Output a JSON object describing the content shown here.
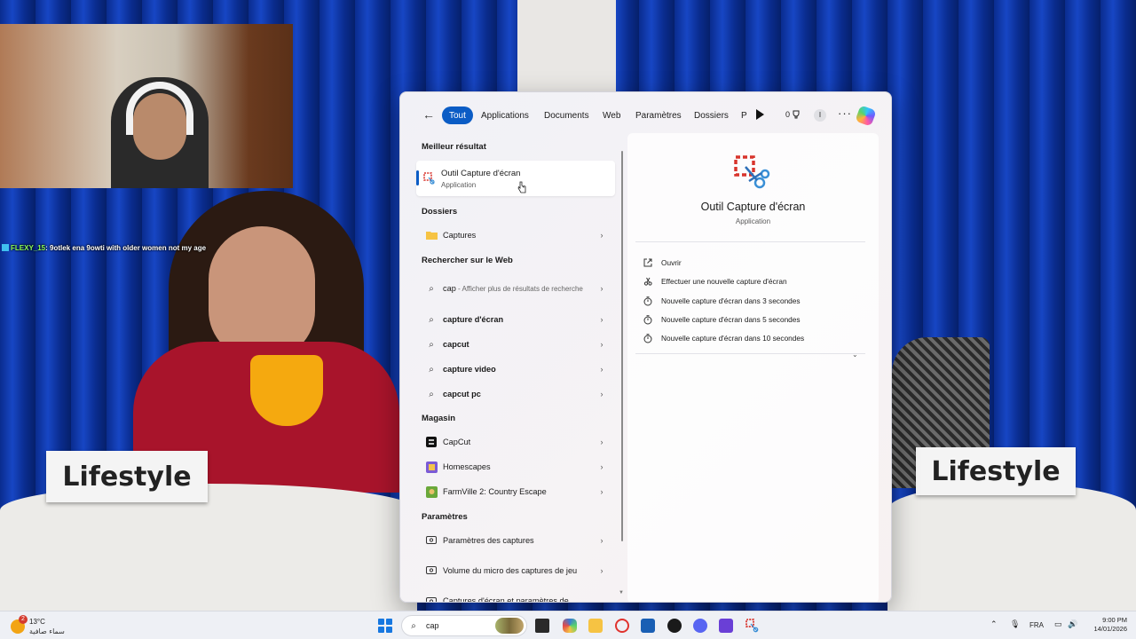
{
  "stream": {
    "chat_user": "FLEXY_15",
    "chat_message": ": 9otlek ena 9owti with older women not my age",
    "nameplate_left": "Lifestyle",
    "nameplate_right": "Lifestyle"
  },
  "search": {
    "tabs": [
      "Tout",
      "Applications",
      "Documents",
      "Web",
      "Paramètres",
      "Dossiers",
      "P"
    ],
    "active_tab": "Tout",
    "points": "0",
    "avatar_initial": "I",
    "best_match_header": "Meilleur résultat",
    "best_match": {
      "name": "Outil Capture d'écran",
      "type": "Application"
    },
    "sections": {
      "folders": "Dossiers",
      "web": "Rechercher sur le Web",
      "store": "Magasin",
      "settings": "Paramètres"
    },
    "folder_items": [
      "Captures"
    ],
    "web_first": {
      "query": "cap",
      "hint": " - Afficher plus de résultats de recherche"
    },
    "web_items": [
      "capture d'écran",
      "capcut",
      "capture video",
      "capcut pc"
    ],
    "store_items": [
      "CapCut",
      "Homescapes",
      "FarmVille 2: Country Escape"
    ],
    "settings_items": [
      "Paramètres des captures",
      "Volume du micro des captures de jeu",
      "Captures d'écran et paramètres de"
    ],
    "detail": {
      "name": "Outil Capture d'écran",
      "type": "Application",
      "actions": [
        "Ouvrir",
        "Effectuer une nouvelle capture d'écran",
        "Nouvelle capture d'écran dans 3 secondes",
        "Nouvelle capture d'écran dans 5 secondes",
        "Nouvelle capture d'écran dans 10 secondes"
      ]
    }
  },
  "taskbar": {
    "weather_badge": "2",
    "temperature": "13°C",
    "condition": "سماء صافية",
    "search_value": "cap",
    "language": "FRA",
    "time": "9:00 PM",
    "date": "14/01/2026"
  }
}
